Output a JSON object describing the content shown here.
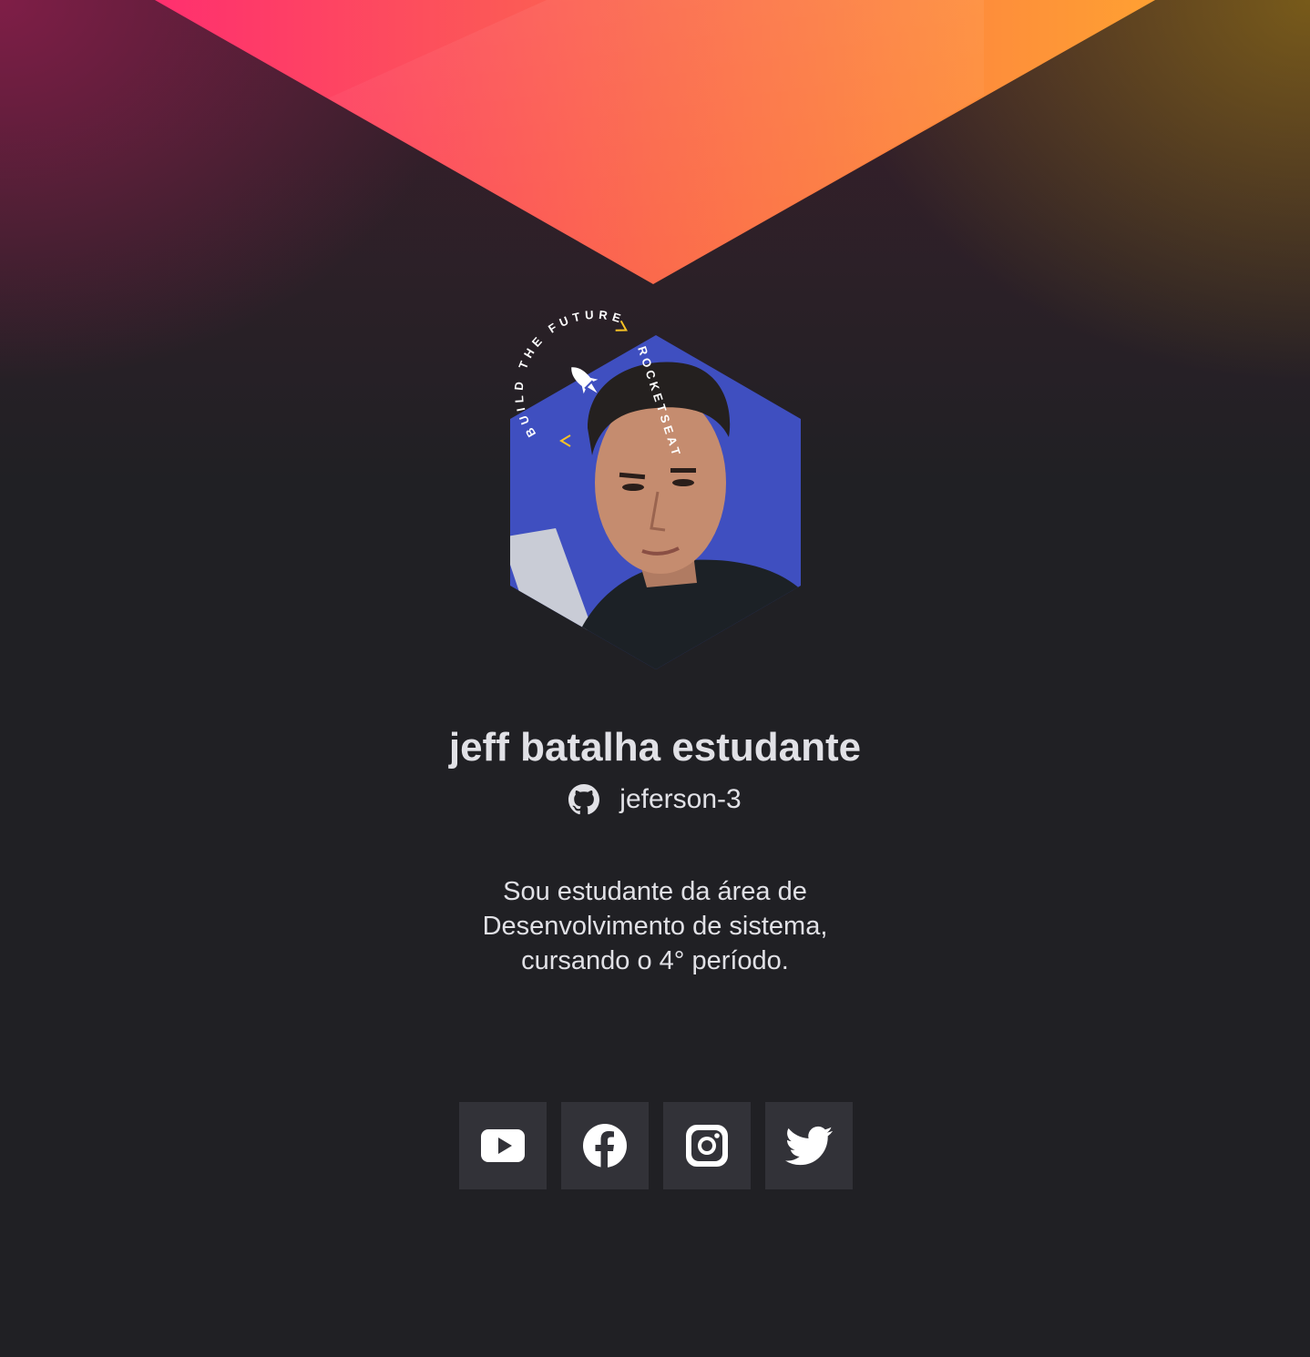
{
  "profile": {
    "name": "jeff batalha estudante",
    "github_username": "jeferson-3",
    "bio": "Sou estudante da área de Desenvolvimento de sistema, cursando o 4° período."
  },
  "badge": {
    "ring_text_top": "BUILD THE FUTURE",
    "ring_text_side": "ROCKETSEAT"
  },
  "socials": [
    {
      "name": "youtube",
      "icon": "youtube-icon"
    },
    {
      "name": "facebook",
      "icon": "facebook-icon"
    },
    {
      "name": "instagram",
      "icon": "instagram-icon"
    },
    {
      "name": "twitter",
      "icon": "twitter-icon"
    }
  ],
  "colors": {
    "background": "#202024",
    "button_bg": "#323238",
    "text": "#e1e1e6",
    "gradient_start": "#ff3b7a",
    "gradient_end": "#ffa030",
    "accent_arrow": "#f7c325",
    "avatar_bg": "#3f4fc0"
  }
}
